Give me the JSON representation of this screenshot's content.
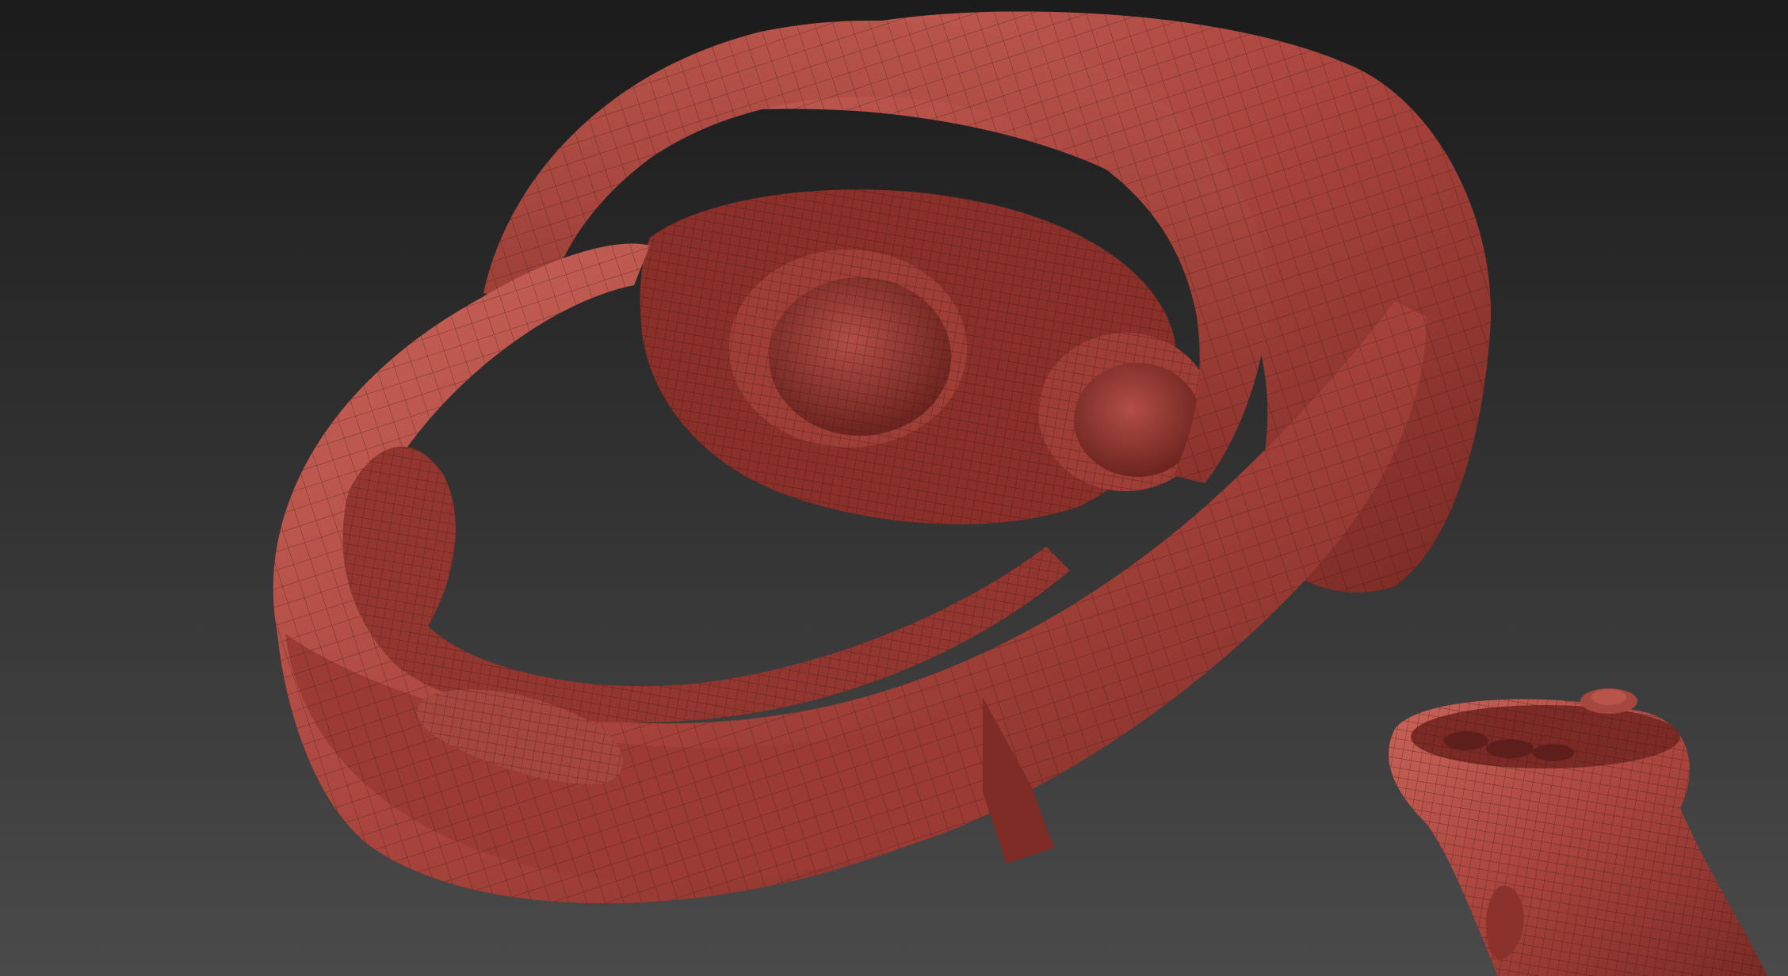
{
  "viewport": {
    "background_top": "#1b1b1b",
    "background_bottom": "#4a4a4a"
  },
  "material": {
    "base_color": "#a8443c",
    "highlight_color": "#c9645a",
    "shadow_color": "#5e1f1c",
    "wire_color": "#3a1412"
  },
  "objects": [
    {
      "name": "vr-headset-mesh"
    },
    {
      "name": "motion-controller-mesh"
    }
  ]
}
